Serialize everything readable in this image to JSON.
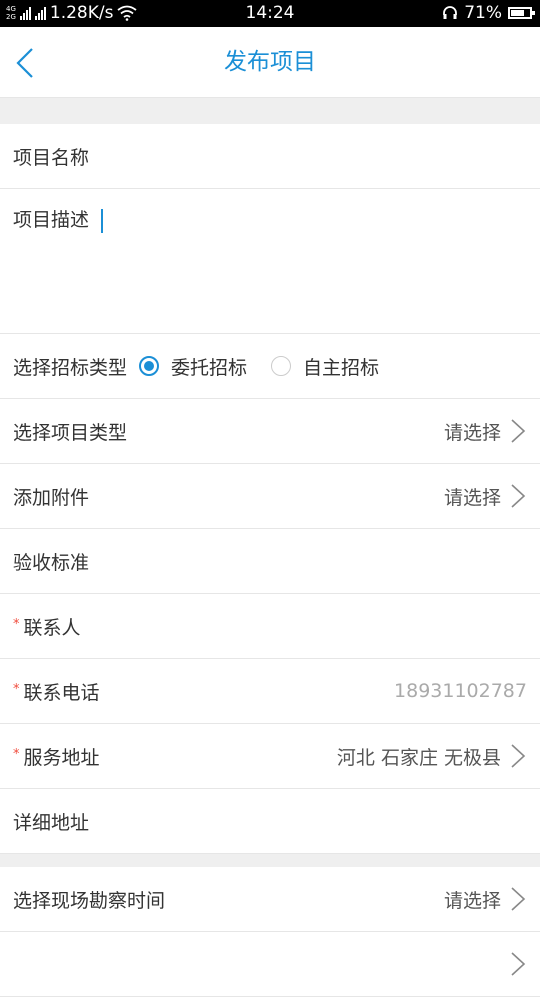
{
  "status": {
    "net_top": "4G",
    "net_bottom": "2G",
    "speed": "1.28K/s",
    "time": "14:24",
    "battery": "71%",
    "battery_fraction": 0.71
  },
  "nav": {
    "title": "发布项目"
  },
  "form": {
    "project_name": "项目名称",
    "project_desc": "项目描述",
    "bid_type_label": "选择招标类型",
    "bid_options": [
      "委托招标",
      "自主招标"
    ],
    "bid_selected_index": 0,
    "project_type_label": "选择项目类型",
    "attachment_label": "添加附件",
    "acceptance_label": "验收标准",
    "contact_label": "联系人",
    "phone_label": "联系电话",
    "phone_value": "18931102787",
    "address_label": "服务地址",
    "address_value": "河北 石家庄 无极县",
    "detail_address_label": "详细地址",
    "survey_time_label": "选择现场勘察时间",
    "placeholder_select": "请选择",
    "required_mark": "*"
  },
  "colors": {
    "accent": "#1b8fd6",
    "required": "#f04b3c"
  },
  "icons": {
    "back": "back-chevron-icon",
    "chevron": "chevron-right-icon",
    "wifi": "wifi-icon",
    "headset": "headset-icon",
    "battery": "battery-icon"
  }
}
